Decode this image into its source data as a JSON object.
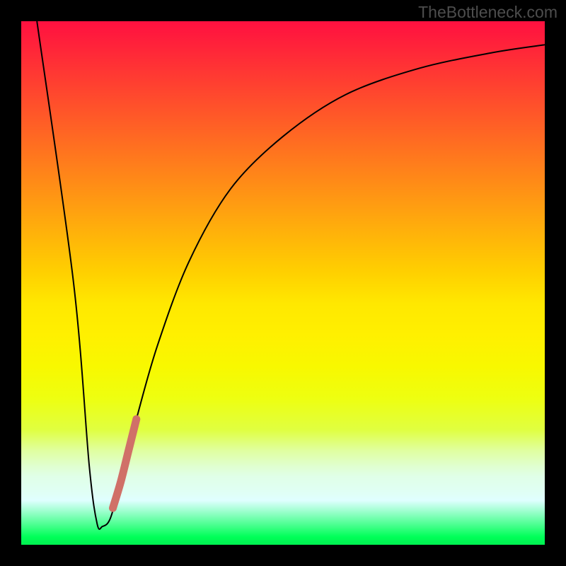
{
  "watermark": "TheBottleneck.com",
  "chart_data": {
    "type": "line",
    "title": "",
    "xlabel": "",
    "ylabel": "",
    "xlim": [
      0,
      100
    ],
    "ylim": [
      0,
      100
    ],
    "series": [
      {
        "name": "bottleneck-curve",
        "color": "#000000",
        "points": [
          {
            "x": 3,
            "y": 100
          },
          {
            "x": 10,
            "y": 50
          },
          {
            "x": 13,
            "y": 15
          },
          {
            "x": 14.5,
            "y": 4
          },
          {
            "x": 15.5,
            "y": 3.5
          },
          {
            "x": 17,
            "y": 5
          },
          {
            "x": 19,
            "y": 12
          },
          {
            "x": 22,
            "y": 24
          },
          {
            "x": 26,
            "y": 38
          },
          {
            "x": 32,
            "y": 54
          },
          {
            "x": 40,
            "y": 68
          },
          {
            "x": 50,
            "y": 78
          },
          {
            "x": 62,
            "y": 86
          },
          {
            "x": 76,
            "y": 91
          },
          {
            "x": 90,
            "y": 94
          },
          {
            "x": 100,
            "y": 95.5
          }
        ]
      },
      {
        "name": "highlight-segment",
        "color": "#d07068",
        "points": [
          {
            "x": 17.5,
            "y": 7
          },
          {
            "x": 19,
            "y": 12
          },
          {
            "x": 20.5,
            "y": 18
          },
          {
            "x": 22,
            "y": 24
          }
        ]
      }
    ]
  }
}
